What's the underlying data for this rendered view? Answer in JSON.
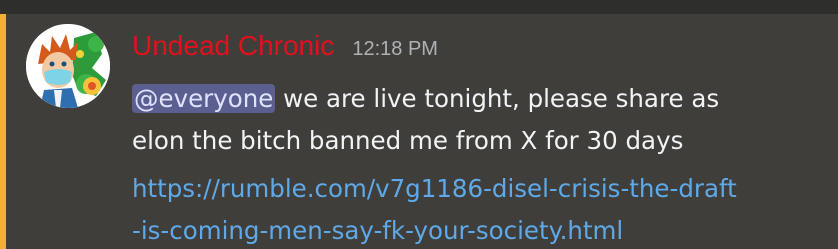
{
  "message": {
    "author": {
      "name": "Undead Chronic",
      "name_color": "#e3101e",
      "avatar": "cartoon-character-avatar"
    },
    "timestamp": "12:18 PM",
    "mention": "@everyone",
    "text_line1": " we are live tonight, please share as",
    "text_line2": "elon the bitch banned me from X for 30 days",
    "link_line1": "https://rumble.com/v7g1186-disel-crisis-the-draft",
    "link_line2": "-is-coming-men-say-fk-your-society.html",
    "link_color": "#5fa9e8",
    "mention_highlight_color": "#f0b232"
  }
}
